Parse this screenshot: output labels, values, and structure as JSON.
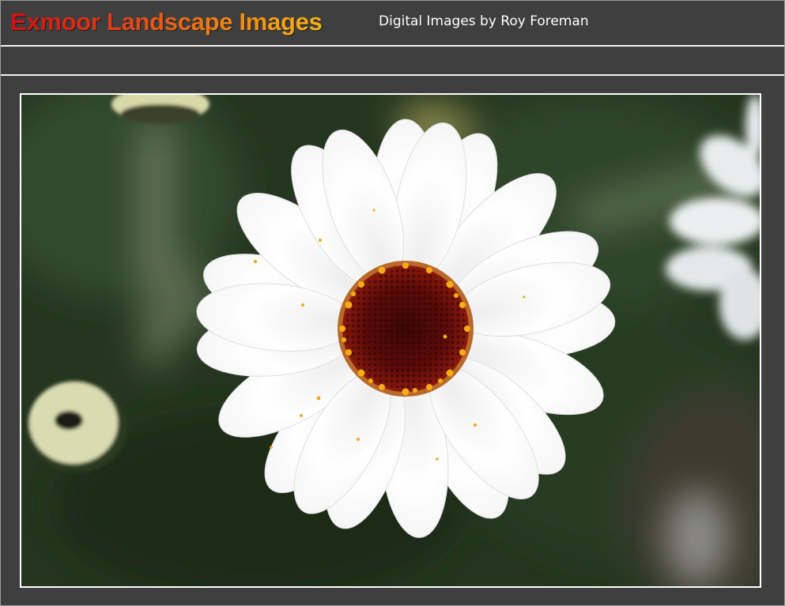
{
  "header": {
    "title": "Exmoor Landscape Images",
    "subtitle": "Digital Images by Roy Foreman"
  },
  "navbar": {
    "items": []
  },
  "main": {
    "photo": {
      "subject": "white-daisy-photo",
      "colors": {
        "background": "#24361f",
        "petal": "#ffffff",
        "center": "#6e0f0c",
        "pollen": "#f2a818"
      }
    }
  },
  "colors": {
    "page_background": "#3f3f3f",
    "divider": "#f2f2f2",
    "title_gradient_start": "#d01010",
    "title_gradient_end": "#f7b418",
    "subtitle": "#ffffff"
  }
}
